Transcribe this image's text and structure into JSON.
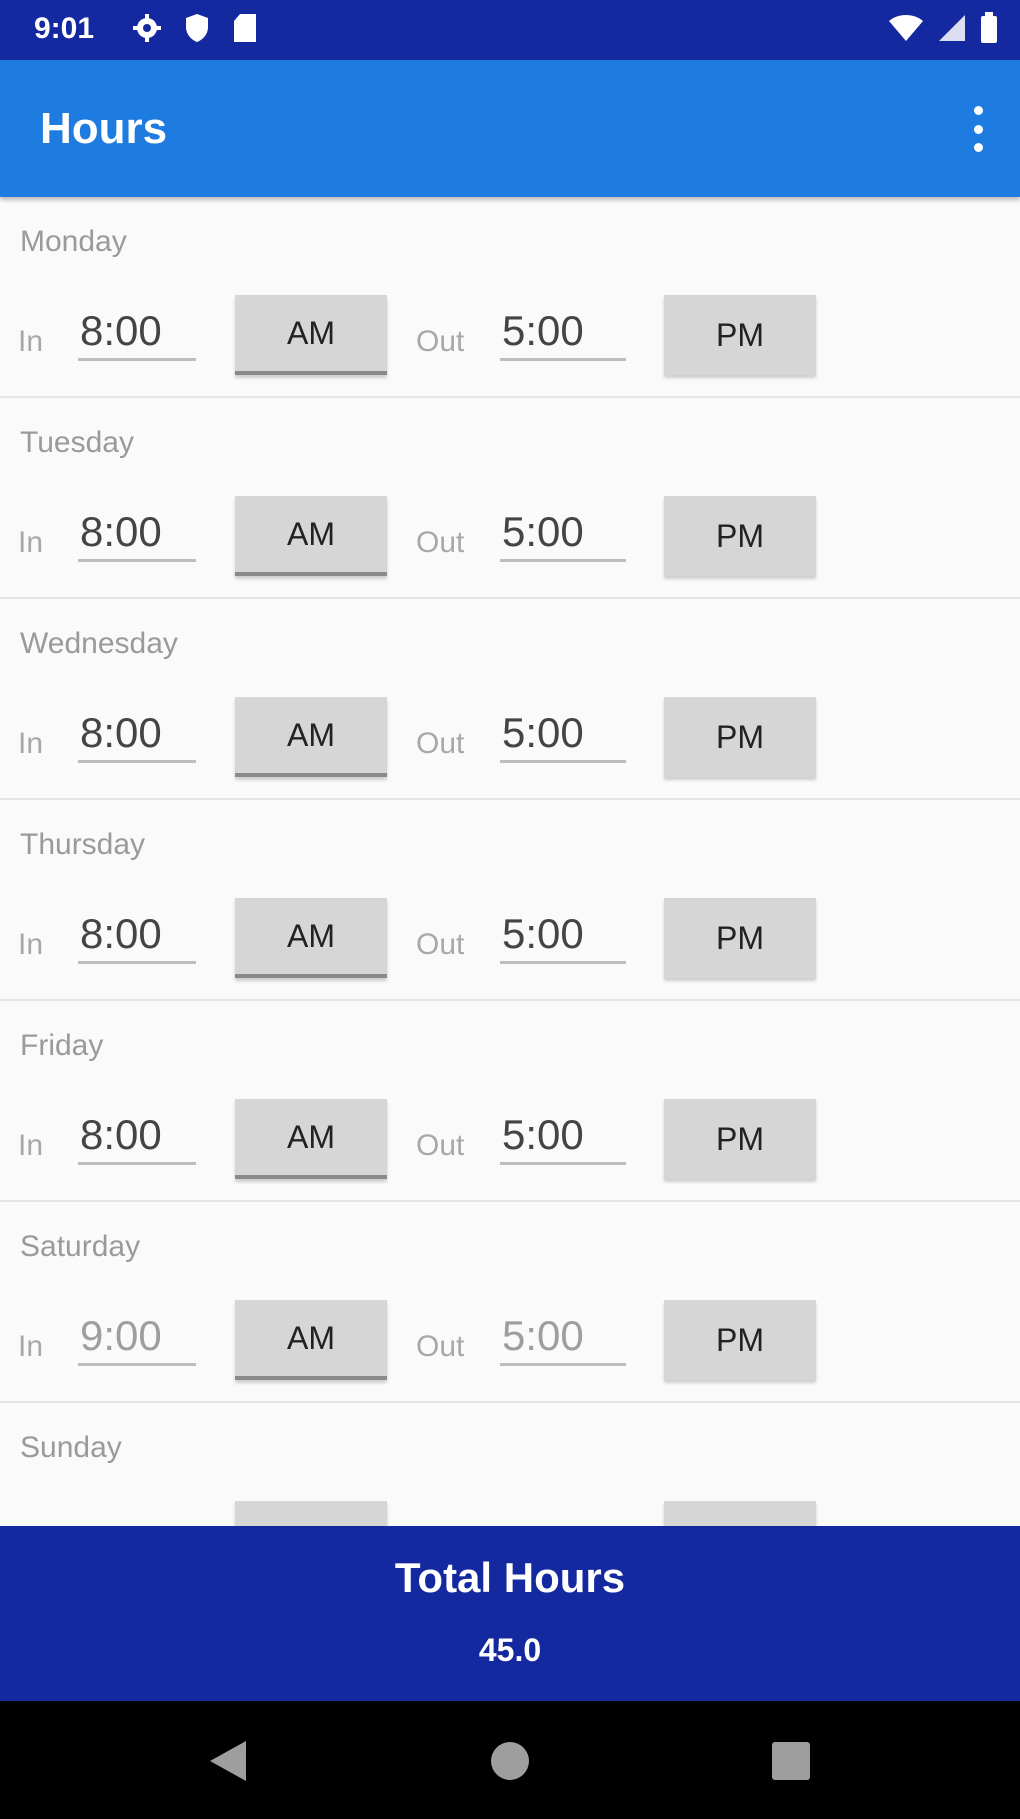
{
  "status_bar": {
    "time": "9:01",
    "icons_left": [
      "gear-icon",
      "shield-icon",
      "sd-card-icon"
    ],
    "icons_right": [
      "wifi-icon",
      "cell-signal-icon",
      "battery-icon"
    ]
  },
  "app_bar": {
    "title": "Hours",
    "menu_icon": "more-vert-icon"
  },
  "labels": {
    "in": "In",
    "out": "Out"
  },
  "days": [
    {
      "name": "Monday",
      "in_time": "8:00",
      "in_period": "AM",
      "out_time": "5:00",
      "out_period": "PM"
    },
    {
      "name": "Tuesday",
      "in_time": "8:00",
      "in_period": "AM",
      "out_time": "5:00",
      "out_period": "PM"
    },
    {
      "name": "Wednesday",
      "in_time": "8:00",
      "in_period": "AM",
      "out_time": "5:00",
      "out_period": "PM"
    },
    {
      "name": "Thursday",
      "in_time": "8:00",
      "in_period": "AM",
      "out_time": "5:00",
      "out_period": "PM"
    },
    {
      "name": "Friday",
      "in_time": "8:00",
      "in_period": "AM",
      "out_time": "5:00",
      "out_period": "PM"
    },
    {
      "name": "Saturday",
      "in_time": "9:00",
      "in_period": "AM",
      "out_time": "5:00",
      "out_period": "PM"
    },
    {
      "name": "Sunday",
      "in_time": "",
      "in_period": "",
      "out_time": "",
      "out_period": ""
    }
  ],
  "total": {
    "title": "Total Hours",
    "value": "45.0"
  },
  "nav": [
    "back-icon",
    "home-icon",
    "recents-icon"
  ],
  "colors": {
    "status_bar": "#1429a0",
    "app_bar": "#1e7be0",
    "total_panel": "#1429a0",
    "button": "#d6d6d6"
  }
}
